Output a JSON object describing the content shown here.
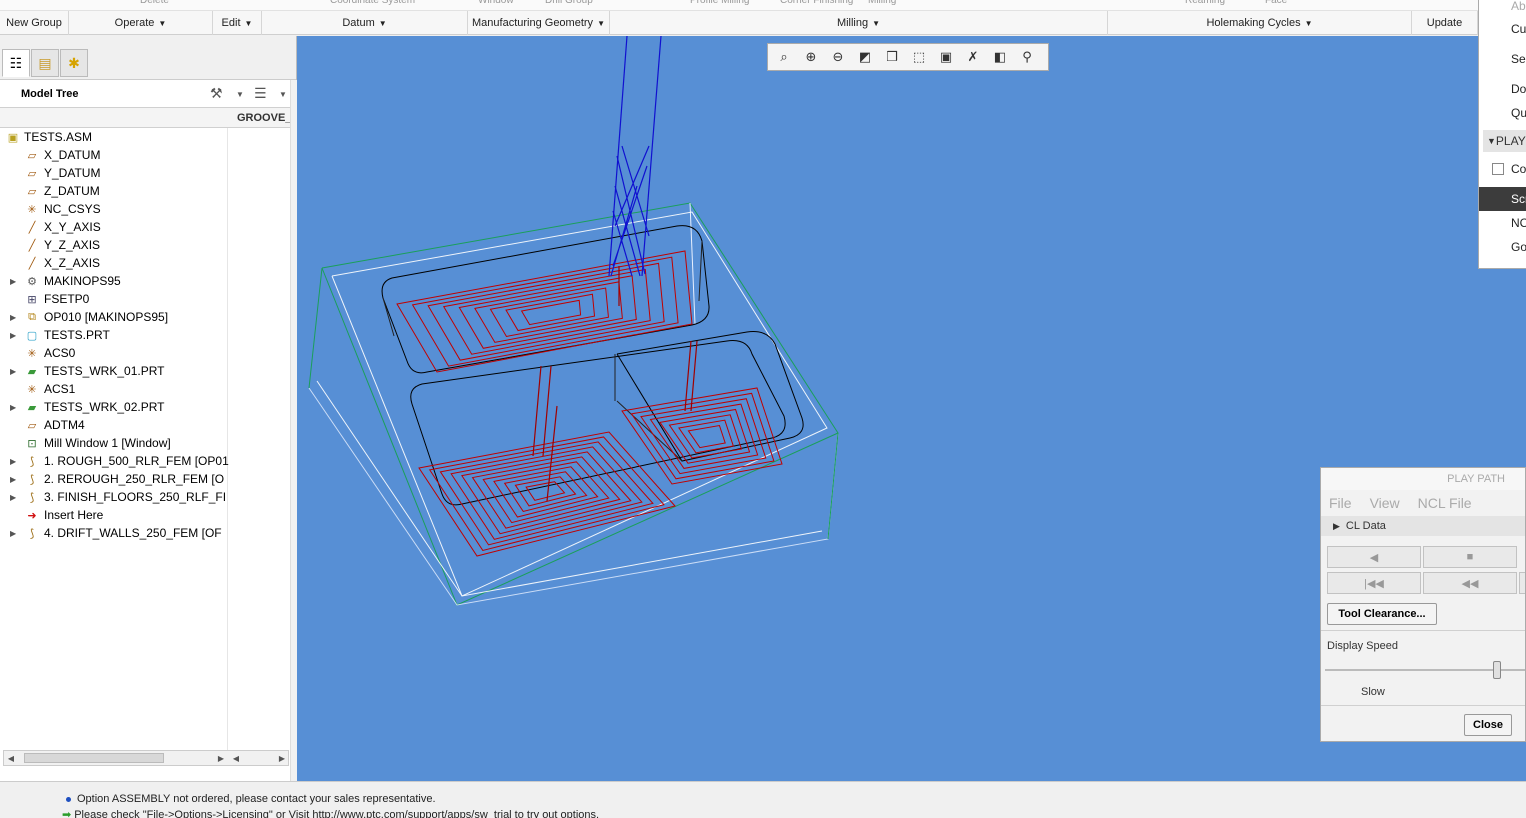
{
  "ribbon": {
    "top_fragments": [
      "Delete",
      "Coordinate System",
      "Window",
      "Drill Group",
      "Profile Milling",
      "Corner Finishing",
      "Milling",
      "Reaming",
      "Face"
    ],
    "groups": [
      {
        "label": "New Group",
        "has_caret": false,
        "width": 69
      },
      {
        "label": "Operate",
        "has_caret": true,
        "width": 144
      },
      {
        "label": "Edit",
        "has_caret": true,
        "width": 49
      },
      {
        "label": "Datum",
        "has_caret": true,
        "width": 206
      },
      {
        "label": "Manufacturing Geometry",
        "has_caret": true,
        "width": 142
      },
      {
        "label": "Milling",
        "has_caret": true,
        "width": 498
      },
      {
        "label": "Holemaking Cycles",
        "has_caret": true,
        "width": 304
      },
      {
        "label": "Update",
        "has_caret": false,
        "width": 66
      }
    ]
  },
  "left_panel": {
    "tree_title": "Model Tree",
    "column_header": "GROOVE_",
    "items": [
      {
        "label": "TESTS.ASM",
        "icon": "assembly-icon",
        "expandable": false,
        "root": true
      },
      {
        "label": "X_DATUM",
        "icon": "datum-plane-icon",
        "expandable": false
      },
      {
        "label": "Y_DATUM",
        "icon": "datum-plane-icon",
        "expandable": false
      },
      {
        "label": "Z_DATUM",
        "icon": "datum-plane-icon",
        "expandable": false
      },
      {
        "label": "NC_CSYS",
        "icon": "csys-icon",
        "expandable": false
      },
      {
        "label": "X_Y_AXIS",
        "icon": "axis-icon",
        "expandable": false
      },
      {
        "label": "Y_Z_AXIS",
        "icon": "axis-icon",
        "expandable": false
      },
      {
        "label": "X_Z_AXIS",
        "icon": "axis-icon",
        "expandable": false
      },
      {
        "label": "MAKINOPS95",
        "icon": "machine-icon",
        "expandable": true
      },
      {
        "label": "FSETP0",
        "icon": "fixture-icon",
        "expandable": false
      },
      {
        "label": "OP010 [MAKINOPS95]",
        "icon": "operation-icon",
        "expandable": true
      },
      {
        "label": "TESTS.PRT",
        "icon": "part-icon",
        "expandable": true
      },
      {
        "label": "ACS0",
        "icon": "csys-icon",
        "expandable": false
      },
      {
        "label": "TESTS_WRK_01.PRT",
        "icon": "workpiece-icon",
        "expandable": true
      },
      {
        "label": "ACS1",
        "icon": "csys-icon",
        "expandable": false
      },
      {
        "label": "TESTS_WRK_02.PRT",
        "icon": "workpiece-icon",
        "expandable": true
      },
      {
        "label": "ADTM4",
        "icon": "datum-plane-icon",
        "expandable": false
      },
      {
        "label": "Mill Window 1 [Window]",
        "icon": "mill-window-icon",
        "expandable": false
      },
      {
        "label": "1. ROUGH_500_RLR_FEM [OP01",
        "icon": "toolpath-icon",
        "expandable": true
      },
      {
        "label": "2. REROUGH_250_RLR_FEM [O",
        "icon": "toolpath-icon",
        "expandable": true
      },
      {
        "label": "3. FINISH_FLOORS_250_RLF_FI",
        "icon": "toolpath-icon",
        "expandable": true
      },
      {
        "label": "Insert Here",
        "icon": "insert-here-icon",
        "expandable": false
      },
      {
        "label": "4. DRIFT_WALLS_250_FEM [OF",
        "icon": "toolpath-new-icon",
        "expandable": true
      }
    ]
  },
  "view_toolbar": [
    "refit-icon",
    "zoom-in-icon",
    "zoom-out-icon",
    "repaint-icon",
    "display-style-icon",
    "saved-orientations-icon",
    "view-manager-icon",
    "datum-display-icon",
    "spin-center-icon",
    "annotation-icon"
  ],
  "context_menu": {
    "items": [
      {
        "label": "Abo",
        "type": "item-faded"
      },
      {
        "label": "Cu",
        "type": "item"
      },
      {
        "label": "Se",
        "type": "item"
      },
      {
        "label": "Do",
        "type": "item"
      },
      {
        "label": "Qu",
        "type": "item"
      },
      {
        "label": "PLAY",
        "type": "section"
      },
      {
        "label": "Co",
        "type": "check"
      },
      {
        "label": "Scr",
        "type": "selected"
      },
      {
        "label": "NC",
        "type": "item"
      },
      {
        "label": "Go",
        "type": "item"
      }
    ]
  },
  "play_path": {
    "title": "PLAY PATH",
    "menu": [
      "File",
      "View",
      "NCL File"
    ],
    "cl_data": "CL Data",
    "tool_clearance": "Tool Clearance...",
    "display_speed": "Display Speed",
    "slow": "Slow",
    "close": "Close",
    "speed_fraction": 0.86
  },
  "status": {
    "messages": [
      "Option ASSEMBLY not ordered, please contact your sales representative.",
      "Please check \"File->Options->Licensing\" or Visit http://www.ptc.com/support/apps/sw_trial to try out options."
    ]
  },
  "colors": {
    "viewport_bg": "#578fd5",
    "toolpath_red": "#c00000",
    "tool_blue": "#1010d0",
    "stock_green": "#1a9f5a"
  }
}
